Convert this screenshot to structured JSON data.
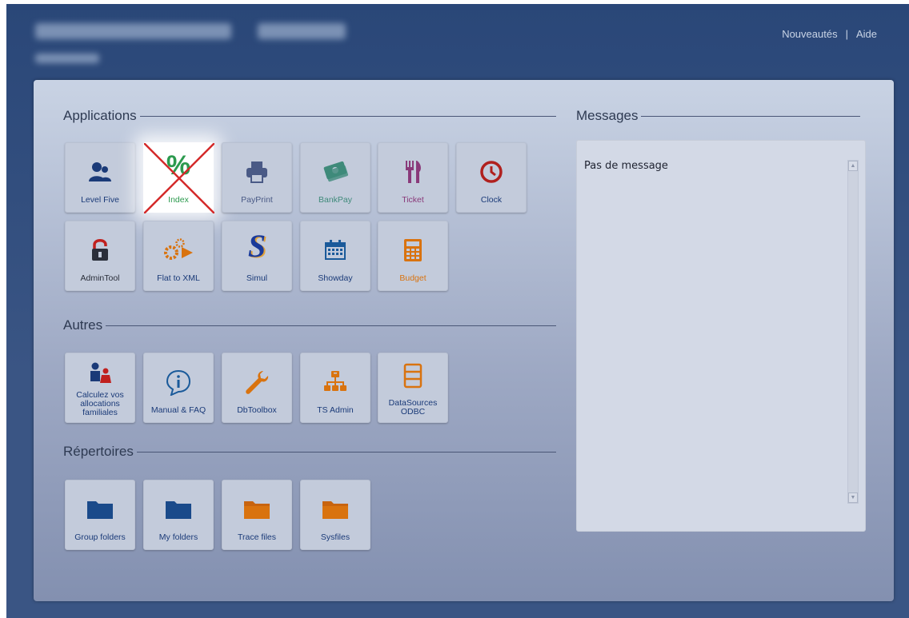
{
  "top_links": {
    "news": "Nouveautés",
    "separator": "|",
    "help": "Aide"
  },
  "sections": {
    "applications": "Applications",
    "autres": "Autres",
    "repertoires": "Répertoires",
    "messages": "Messages"
  },
  "applications": [
    {
      "label": "Level Five",
      "icon": "users-icon"
    },
    {
      "label": "Index",
      "icon": "percent-icon"
    },
    {
      "label": "PayPrint",
      "icon": "printer-icon"
    },
    {
      "label": "BankPay",
      "icon": "banknote-icon"
    },
    {
      "label": "Ticket",
      "icon": "fork-knife-icon"
    },
    {
      "label": "Clock",
      "icon": "clock-icon"
    },
    {
      "label": "AdminTool",
      "icon": "lock-icon"
    },
    {
      "label": "Flat to XML",
      "icon": "gears-arrow-icon"
    },
    {
      "label": "Simul",
      "icon": "s-logo-icon"
    },
    {
      "label": "Showday",
      "icon": "calendar-icon"
    },
    {
      "label": "Budget",
      "icon": "calculator-icon"
    }
  ],
  "autres": [
    {
      "label": "Calculez vos allocations familiales",
      "icon": "family-icon"
    },
    {
      "label": "Manual & FAQ",
      "icon": "info-bubble-icon"
    },
    {
      "label": "DbToolbox",
      "icon": "wrench-icon"
    },
    {
      "label": "TS Admin",
      "icon": "org-chart-icon"
    },
    {
      "label": "DataSources ODBC",
      "icon": "database-icon"
    }
  ],
  "repertoires": [
    {
      "label": "Group folders",
      "icon": "folder-icon"
    },
    {
      "label": "My folders",
      "icon": "folder-icon"
    },
    {
      "label": "Trace files",
      "icon": "folder-icon"
    },
    {
      "label": "Sysfiles",
      "icon": "folder-icon"
    }
  ],
  "messages": {
    "text": "Pas de message"
  },
  "colors": {
    "header": "#2a4778",
    "panel": "#9ea9c4",
    "tile": "#c3cbdb",
    "label_blue": "#1a3a78",
    "orange": "#d9730f",
    "red": "#c0201e",
    "green": "#2c9a4e"
  }
}
